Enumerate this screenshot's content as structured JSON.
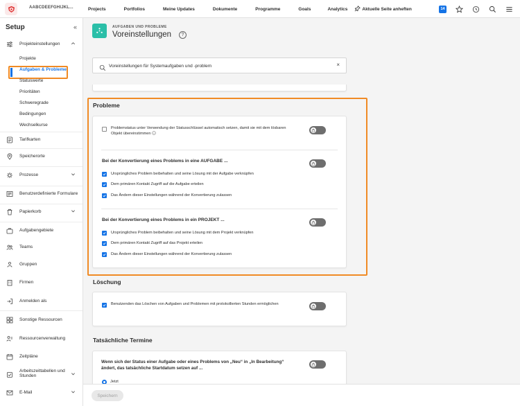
{
  "topbar": {
    "company": "AABCDEEFGHIJKL...",
    "nav": [
      "Projects",
      "Portfolios",
      "Meine Updates",
      "Dokumente",
      "Programme",
      "Goals",
      "Analytics"
    ],
    "pin_label": "Aktuelle Seite anheften",
    "notification_count": "14"
  },
  "sidebar": {
    "title": "Setup",
    "collapse_glyph": "«",
    "projekt_group": "Projekteinstellungen",
    "subitems": [
      "Projekte",
      "Aufgaben & Probleme",
      "Statuswerte",
      "Prioritäten",
      "Schweregrade",
      "Bedingungen",
      "Wechselkurse"
    ],
    "items": [
      {
        "label": "Tarifkarten",
        "icon": "rate-card-icon"
      },
      {
        "label": "Speicherorte",
        "icon": "location-icon"
      },
      {
        "label": "Prozesse",
        "icon": "process-icon",
        "expandable": true
      },
      {
        "label": "Benutzerdefinierte Formulare",
        "icon": "form-icon"
      },
      {
        "label": "Papierkorb",
        "icon": "trash-icon",
        "expandable": true
      },
      {
        "label": "Aufgabengebiete",
        "icon": "job-role-icon"
      },
      {
        "label": "Teams",
        "icon": "teams-icon"
      },
      {
        "label": "Gruppen",
        "icon": "groups-icon"
      },
      {
        "label": "Firmen",
        "icon": "company-icon"
      },
      {
        "label": "Anmelden als",
        "icon": "login-as-icon"
      },
      {
        "label": "Sonstige Ressourcen",
        "icon": "resources-icon"
      },
      {
        "label": "Ressourcenverwaltung",
        "icon": "resource-mgmt-icon"
      },
      {
        "label": "Zeitpläne",
        "icon": "schedule-icon"
      },
      {
        "label": "Arbeitszeittabellen und Stunden",
        "icon": "timesheet-icon",
        "expandable": true
      },
      {
        "label": "E-Mail",
        "icon": "email-icon",
        "expandable": true
      }
    ]
  },
  "header": {
    "kicker": "AUFGABEN UND PROBLEME",
    "title": "Voreinstellungen",
    "help": "?"
  },
  "search": {
    "value": "Voreinstellungen für Systemaufgaben und -problem",
    "clear": "×"
  },
  "probleme": {
    "title": "Probleme",
    "option1": "Problemstatus unter Verwendung der Statusschlüssel automatisch setzen, damit sie mit dem lösbaren Objekt übereinstimmen",
    "group_task": {
      "title": "Bei der Konvertierung eines Problems in eine AUFGABE ...",
      "items": [
        "Ursprüngliches Problem beibehalten und seine Lösung mit der Aufgabe verknüpfen",
        "Dem primären Kontakt Zugriff auf die Aufgabe erteilen",
        "Das Ändern dieser Einstellungen während der Konvertierung zulassen"
      ]
    },
    "group_project": {
      "title": "Bei der Konvertierung eines Problems in ein PROJEKT ...",
      "items": [
        "Ursprüngliches Problem beibehalten und seine Lösung mit dem Projekt verknüpfen",
        "Dem primären Kontakt Zugriff auf das Projekt erteilen",
        "Das Ändern dieser Einstellungen während der Konvertierung zulassen"
      ]
    }
  },
  "loeschung": {
    "title": "Löschung",
    "option": "Benutzenden das Löschen von Aufgaben und Problemen mit protokollierten Stunden ermöglichen"
  },
  "termine": {
    "title": "Tatsächliche Termine",
    "question": "Wenn sich der Status einer Aufgabe oder eines Problems von „Neu“ in „In Bearbeitung“ ändert, das tatsächliche Startdatum setzen auf ...",
    "radio_label": "Jetzt"
  },
  "footer": {
    "save_label": "Speichern"
  },
  "colors": {
    "accent": "#1473e6",
    "highlight": "#f08a24",
    "header_icon": "#2bbfa8"
  }
}
